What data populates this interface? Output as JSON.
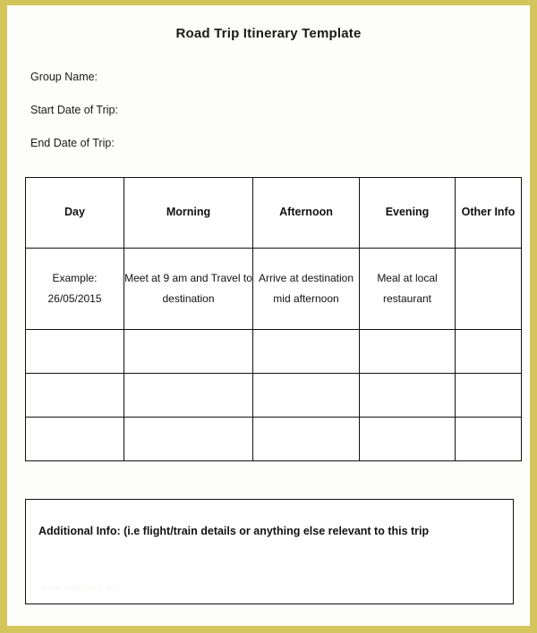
{
  "document": {
    "title": "Road Trip Itinerary Template"
  },
  "fields": [
    {
      "label": "Group Name:",
      "value": ""
    },
    {
      "label": "Start Date  of Trip:",
      "value": ""
    },
    {
      "label": "End Date of Trip:",
      "value": ""
    }
  ],
  "table": {
    "headers": [
      "Day",
      "Morning",
      "Afternoon",
      "Evening",
      "Other Info"
    ],
    "rows": [
      {
        "type": "example",
        "cells": [
          "Example: 26/05/2015",
          "Meet at 9 am and Travel to destination",
          "Arrive at destination mid afternoon",
          "Meal at local restaurant",
          ""
        ]
      },
      {
        "type": "blank",
        "cells": [
          "",
          "",
          "",
          "",
          ""
        ]
      },
      {
        "type": "blank",
        "cells": [
          "",
          "",
          "",
          "",
          ""
        ]
      },
      {
        "type": "blank",
        "cells": [
          "",
          "",
          "",
          "",
          ""
        ]
      }
    ]
  },
  "additional_info": {
    "label": "Additional Info:  (i.e flight/train details or anything else relevant to this trip",
    "value": "",
    "watermark": "www.template.net"
  },
  "colors": {
    "frame": "#d4c45c",
    "page": "#fdfdfb",
    "text": "#111111",
    "border": "#111111"
  }
}
